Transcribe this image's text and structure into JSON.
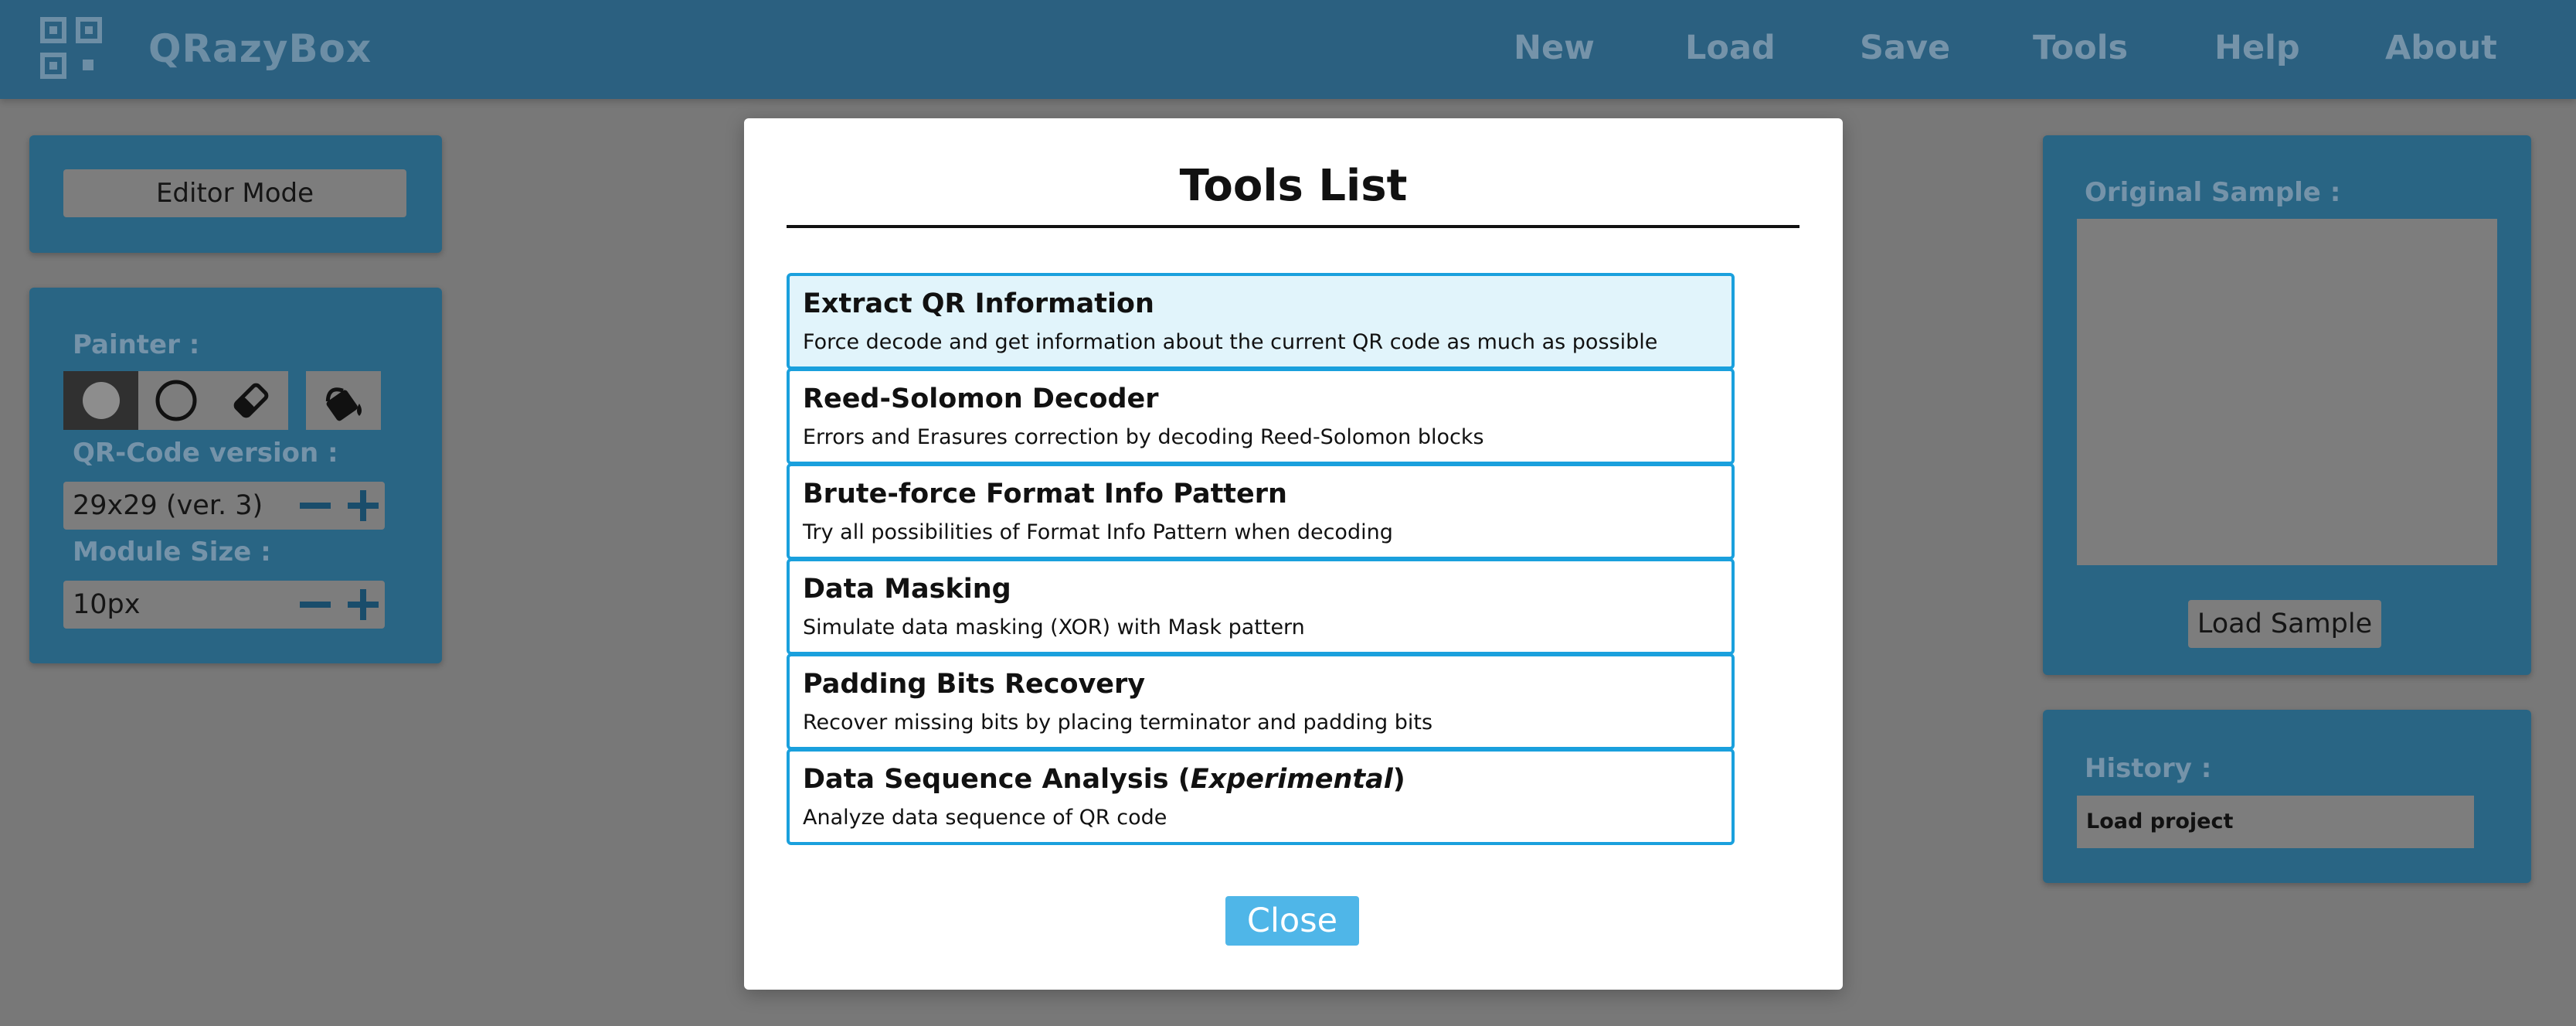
{
  "header": {
    "app_name": "QRazyBox",
    "nav": [
      "New",
      "Load",
      "Save",
      "Tools",
      "Help",
      "About"
    ]
  },
  "left_panel": {
    "editor_mode_label": "Editor Mode",
    "painter_label": "Painter :",
    "painter_tools": [
      {
        "icon": "filled-circle-icon",
        "active": true
      },
      {
        "icon": "empty-circle-icon",
        "active": false
      },
      {
        "icon": "eraser-icon",
        "active": false
      },
      {
        "icon": "paint-bucket-icon",
        "active": false
      }
    ],
    "qr_version_label": "QR-Code version :",
    "qr_version_value": "29x29 (ver. 3)",
    "module_size_label": "Module Size :",
    "module_size_value": "10px"
  },
  "right_panel": {
    "original_sample_label": "Original Sample :",
    "load_sample_label": "Load Sample",
    "history_label": "History :",
    "history_items": [
      "Load project"
    ]
  },
  "modal": {
    "title": "Tools List",
    "tools": [
      {
        "name": "Extract QR Information",
        "description": "Force decode and get information about the current QR code as much as possible"
      },
      {
        "name": "Reed-Solomon Decoder",
        "description": "Errors and Erasures correction by decoding Reed-Solomon blocks"
      },
      {
        "name": "Brute-force Format Info Pattern",
        "description": "Try all possibilities of Format Info Pattern when decoding"
      },
      {
        "name": "Data Masking",
        "description": "Simulate data masking (XOR) with Mask pattern"
      },
      {
        "name": "Padding Bits Recovery",
        "description": "Recover missing bits by placing terminator and padding bits"
      },
      {
        "name_prefix": "Data Sequence Analysis (",
        "name_emphasis": "Experimental",
        "name_suffix": ")",
        "description": "Analyze data sequence of QR code"
      }
    ],
    "close_label": "Close"
  },
  "colors": {
    "backdrop": "#787878",
    "header": "#2b6080",
    "panel": "#296584",
    "accent": "#1aa0dd",
    "close_button": "#4fb6e8",
    "highlight_row": "#e1f4fb"
  }
}
